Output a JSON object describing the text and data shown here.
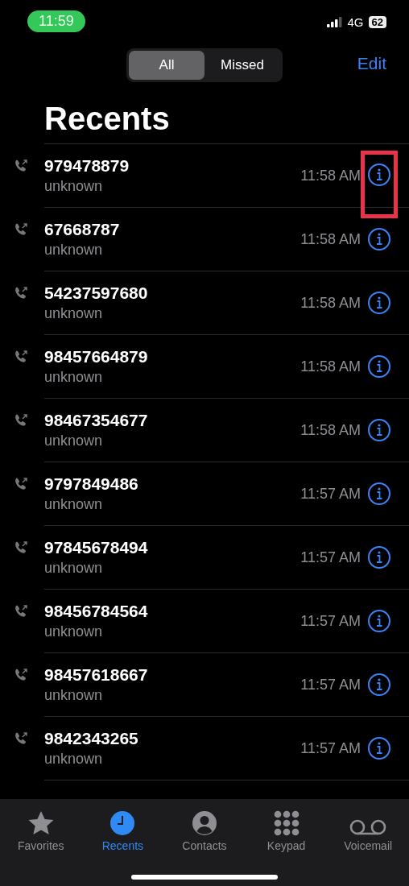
{
  "status_bar": {
    "time": "11:59",
    "network": "4G",
    "battery": "62"
  },
  "segments": [
    {
      "label": "All",
      "selected": true
    },
    {
      "label": "Missed",
      "selected": false
    }
  ],
  "edit_button": "Edit",
  "title": "Recents",
  "calls": [
    {
      "number": "979478879",
      "label": "unknown",
      "time": "11:58 AM",
      "highlighted": true
    },
    {
      "number": "67668787",
      "label": "unknown",
      "time": "11:58 AM",
      "highlighted": false
    },
    {
      "number": "54237597680",
      "label": "unknown",
      "time": "11:58 AM",
      "highlighted": false
    },
    {
      "number": "98457664879",
      "label": "unknown",
      "time": "11:58 AM",
      "highlighted": false
    },
    {
      "number": "98467354677",
      "label": "unknown",
      "time": "11:58 AM",
      "highlighted": false
    },
    {
      "number": "9797849486",
      "label": "unknown",
      "time": "11:57 AM",
      "highlighted": false
    },
    {
      "number": "97845678494",
      "label": "unknown",
      "time": "11:57 AM",
      "highlighted": false
    },
    {
      "number": "98456784564",
      "label": "unknown",
      "time": "11:57 AM",
      "highlighted": false
    },
    {
      "number": "98457618667",
      "label": "unknown",
      "time": "11:57 AM",
      "highlighted": false
    },
    {
      "number": "9842343265",
      "label": "unknown",
      "time": "11:57 AM",
      "highlighted": false
    }
  ],
  "tab_bar": [
    {
      "kind": "star",
      "label": "Favorites",
      "selected": false
    },
    {
      "kind": "clock",
      "label": "Recents",
      "selected": true
    },
    {
      "kind": "person",
      "label": "Contacts",
      "selected": false
    },
    {
      "kind": "keypad",
      "label": "Keypad",
      "selected": false
    },
    {
      "kind": "voicemail",
      "label": "Voicemail",
      "selected": false
    }
  ]
}
